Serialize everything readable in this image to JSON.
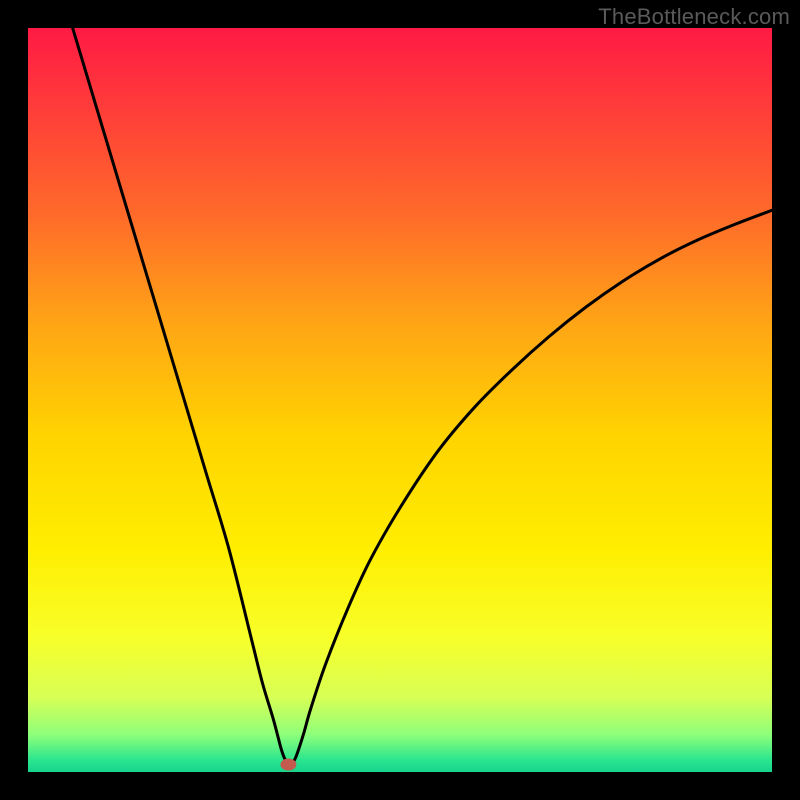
{
  "attribution": "TheBottleneck.com",
  "chart_data": {
    "type": "line",
    "title": "",
    "xlabel": "",
    "ylabel": "",
    "xlim": [
      0,
      100
    ],
    "ylim": [
      0,
      100
    ],
    "grid": false,
    "legend": false,
    "series": [
      {
        "name": "curve",
        "x": [
          6,
          9,
          12,
          15,
          18,
          21,
          24,
          27,
          30,
          31.5,
          33,
          34,
          34.5,
          35,
          35.5,
          36,
          37,
          38,
          40,
          43,
          46,
          50,
          55,
          60,
          65,
          70,
          75,
          80,
          85,
          90,
          95,
          100
        ],
        "y": [
          100,
          90,
          80,
          70,
          60,
          50,
          40,
          30,
          18,
          12,
          7,
          3.2,
          1.8,
          1.0,
          1.2,
          2.0,
          5,
          8.5,
          14.5,
          22,
          28.5,
          35.5,
          43,
          49,
          54,
          58.5,
          62.5,
          66,
          69,
          71.5,
          73.6,
          75.5
        ]
      }
    ],
    "marker": {
      "x": 35,
      "y": 1.0,
      "color": "#c35b4f"
    },
    "gradient_stops": [
      {
        "offset": 0.0,
        "color": "#ff1a44"
      },
      {
        "offset": 0.1,
        "color": "#ff3a3a"
      },
      {
        "offset": 0.25,
        "color": "#ff6a2a"
      },
      {
        "offset": 0.4,
        "color": "#ffa615"
      },
      {
        "offset": 0.55,
        "color": "#ffd400"
      },
      {
        "offset": 0.7,
        "color": "#ffee00"
      },
      {
        "offset": 0.82,
        "color": "#f7ff2a"
      },
      {
        "offset": 0.9,
        "color": "#d7ff55"
      },
      {
        "offset": 0.95,
        "color": "#8dff7a"
      },
      {
        "offset": 0.985,
        "color": "#28e58f"
      },
      {
        "offset": 1.0,
        "color": "#17d38e"
      }
    ]
  }
}
